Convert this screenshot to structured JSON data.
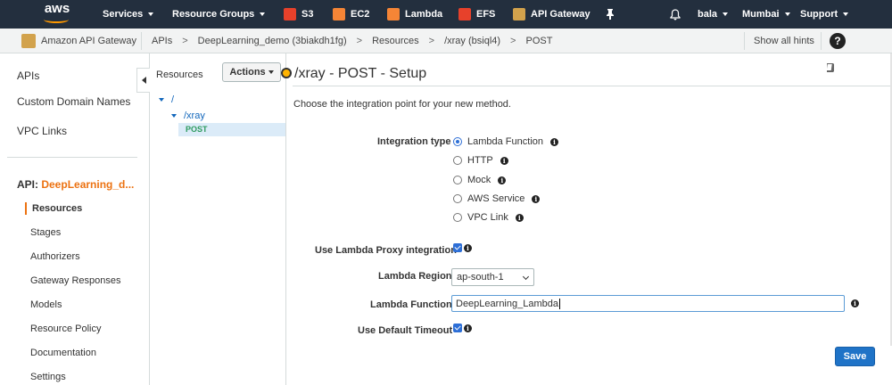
{
  "topnav": {
    "logo_text": "aws",
    "services": "Services",
    "resource_groups": "Resource Groups",
    "shortcuts": [
      {
        "label": "S3",
        "icon": "s3-icon",
        "color": "#e7412b"
      },
      {
        "label": "EC2",
        "icon": "ec2-icon",
        "color": "#f58536"
      },
      {
        "label": "Lambda",
        "icon": "lambda-icon",
        "color": "#f58536"
      },
      {
        "label": "EFS",
        "icon": "efs-icon",
        "color": "#e7412b"
      },
      {
        "label": "API Gateway",
        "icon": "api-gateway-icon",
        "color": "#d2a24c"
      }
    ],
    "user": "bala",
    "region": "Mumbai",
    "support": "Support"
  },
  "subbar": {
    "service_name": "Amazon API Gateway",
    "crumbs": [
      "APIs",
      "DeepLearning_demo (3biakdh1fg)",
      "Resources",
      "/xray (bsiql4)",
      "POST"
    ],
    "separator": ">",
    "hints": "Show all hints",
    "help": "?"
  },
  "leftnav": {
    "links": [
      "APIs",
      "Custom Domain Names",
      "VPC Links"
    ],
    "api_prefix": "API:",
    "api_name": "DeepLearning_d...",
    "items": [
      "Resources",
      "Stages",
      "Authorizers",
      "Gateway Responses",
      "Models",
      "Resource Policy",
      "Documentation",
      "Settings"
    ]
  },
  "tree": {
    "title": "Resources",
    "actions": "Actions",
    "nodes": [
      "/",
      "/xray"
    ],
    "method": "POST"
  },
  "main": {
    "title": "/xray - POST - Setup",
    "intro": "Choose the integration point for your new method.",
    "integration_type_label": "Integration type",
    "integration_options": [
      "Lambda Function",
      "HTTP",
      "Mock",
      "AWS Service",
      "VPC Link"
    ],
    "selected_option": "Lambda Function",
    "proxy_label": "Use Lambda Proxy integration",
    "proxy_checked": true,
    "region_label": "Lambda Region",
    "region_value": "ap-south-1",
    "function_label": "Lambda Function",
    "function_value": "DeepLearning_Lambda",
    "timeout_label": "Use Default Timeout",
    "timeout_checked": true,
    "save": "Save",
    "info_glyph": "i"
  }
}
